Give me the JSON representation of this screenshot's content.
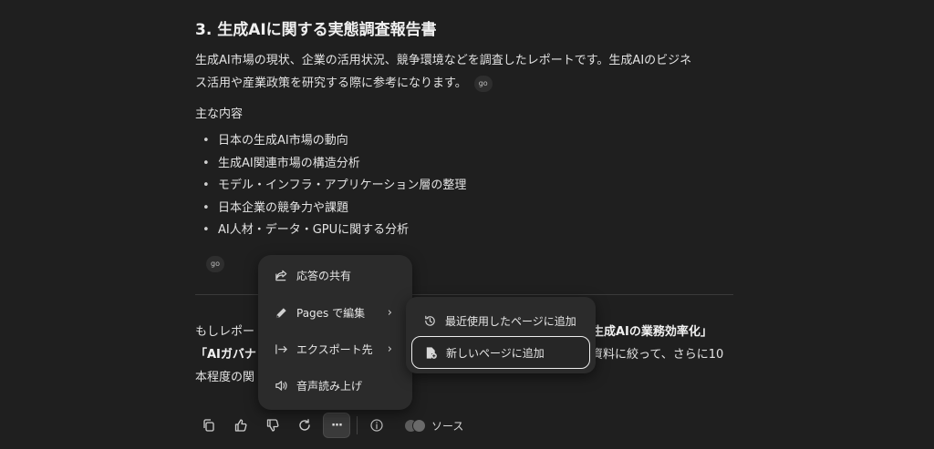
{
  "article": {
    "heading": "3. 生成AIに関する実態調査報告書",
    "para_line1": "生成AI市場の現状、企業の活用状況、競争環境などを調査したレポートです。生成AIのビジネ",
    "para_line2": "ス活用や産業政策を研究する際に参考になります。",
    "source_chip": "go",
    "subhead": "主な内容",
    "bullets": [
      "日本の生成AI市場の動向",
      "生成AI関連市場の構造分析",
      "モデル・インフラ・アプリケーション層の整理",
      "日本企業の競争力や課題",
      "AI人材・データ・GPUに関する分析"
    ],
    "bullet_marker": "•",
    "source_chip2": "go",
    "tail_line1_left": "もしレポー",
    "tail_line1_right": "生成AIの業務効率化」",
    "tail_line2_left": "「AIガバナ",
    "tail_line2_right": "資料に絞って、さらに10",
    "tail_line3_left": "本程度の関"
  },
  "menu": {
    "items": [
      {
        "label": "応答の共有",
        "icon": "share-icon"
      },
      {
        "label": "Pages で編集",
        "icon": "edit-icon",
        "chevron": "›"
      },
      {
        "label": "エクスポート先",
        "icon": "export-icon",
        "chevron": "›"
      },
      {
        "label": "音声読み上げ",
        "icon": "speaker-icon"
      }
    ]
  },
  "submenu": {
    "items": [
      {
        "label": "最近使用したページに追加",
        "icon": "history-icon"
      },
      {
        "label": "新しいページに追加",
        "icon": "new-page-icon"
      }
    ]
  },
  "toolbar": {
    "more_glyph": "···",
    "sources_label": "ソース"
  },
  "colors": {
    "background": "#1f1f1f",
    "menu_bg": "#2b2b2b",
    "text": "#e6e6e6"
  }
}
